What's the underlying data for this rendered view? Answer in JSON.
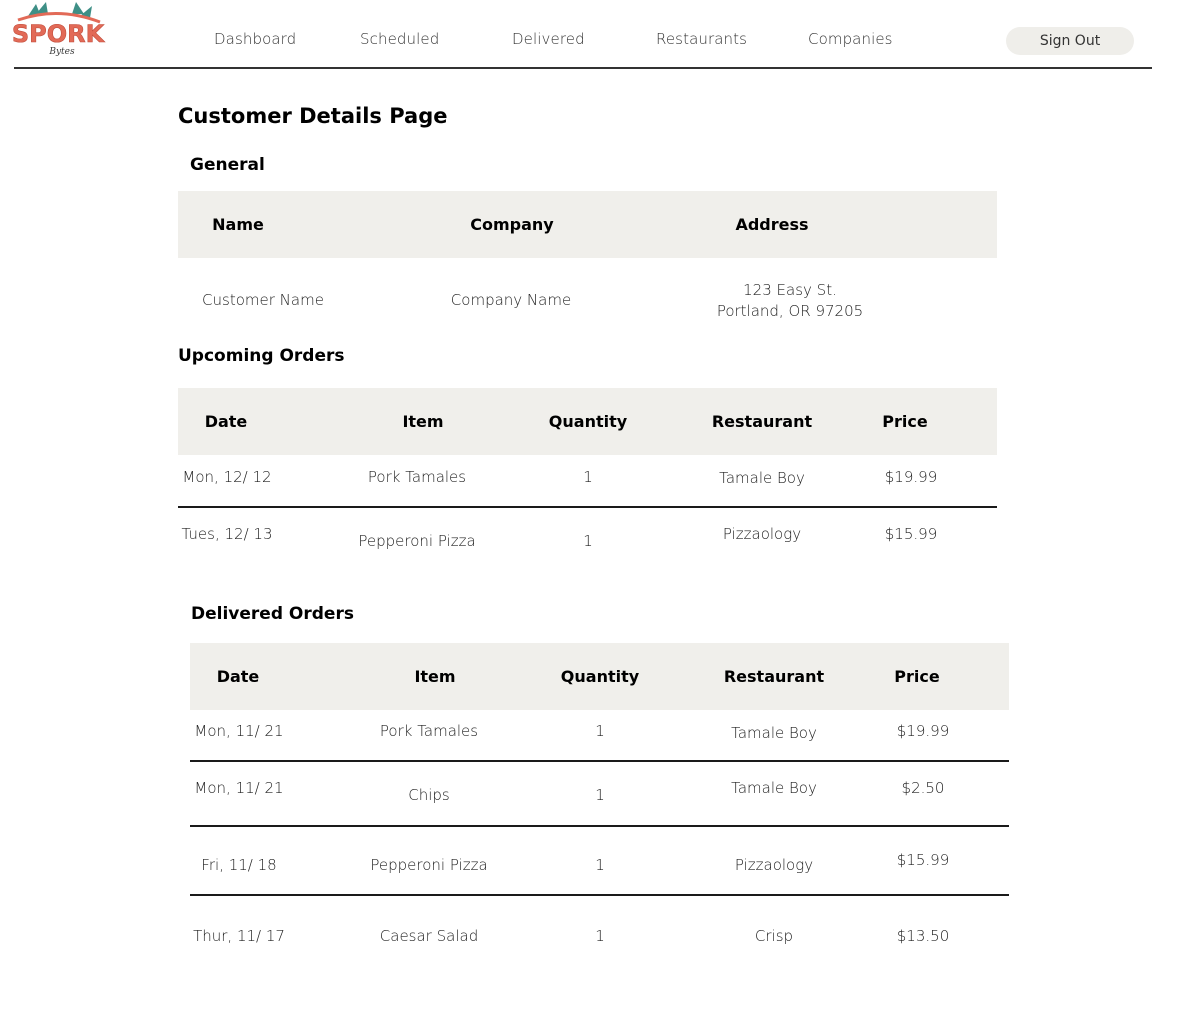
{
  "brand": {
    "logo_text": "SPORK",
    "logo_subtext": "Bytes"
  },
  "nav": {
    "items": [
      "Dashboard",
      "Scheduled",
      "Delivered",
      "Restaurants",
      "Companies"
    ],
    "sign_out": "Sign Out"
  },
  "page": {
    "title": "Customer Details Page"
  },
  "general": {
    "title": "General",
    "headers": [
      "Name",
      "Company",
      "Address"
    ],
    "name": "Customer Name",
    "company": "Company Name",
    "address_line1": "123 Easy St.",
    "address_line2": "Portland, OR 97205"
  },
  "upcoming": {
    "title": "Upcoming Orders",
    "headers": [
      "Date",
      "Item",
      "Quantity",
      "Restaurant",
      "Price"
    ],
    "rows": [
      [
        "Mon, 12/ 12",
        "Pork Tamales",
        "1",
        "Tamale Boy",
        "$19.99"
      ],
      [
        "Tues, 12/ 13",
        "Pepperoni Pizza",
        "1",
        "Pizzaology",
        "$15.99"
      ]
    ]
  },
  "delivered": {
    "title": "Delivered Orders",
    "headers": [
      "Date",
      "Item",
      "Quantity",
      "Restaurant",
      "Price"
    ],
    "rows": [
      [
        "Mon, 11/ 21",
        "Pork Tamales",
        "1",
        "Tamale Boy",
        "$19.99"
      ],
      [
        "Mon, 11/ 21",
        "Chips",
        "1",
        "Tamale Boy",
        "$2.50"
      ],
      [
        "Fri, 11/ 18",
        "Pepperoni Pizza",
        "1",
        "Pizzaology",
        "$15.99"
      ],
      [
        "Thur, 11/ 17",
        "Caesar Salad",
        "1",
        "Crisp",
        "$13.50"
      ]
    ]
  },
  "colors": {
    "brand": "#e26a57",
    "header_fill": "#f0efeb",
    "rule": "#1a1a1a"
  }
}
